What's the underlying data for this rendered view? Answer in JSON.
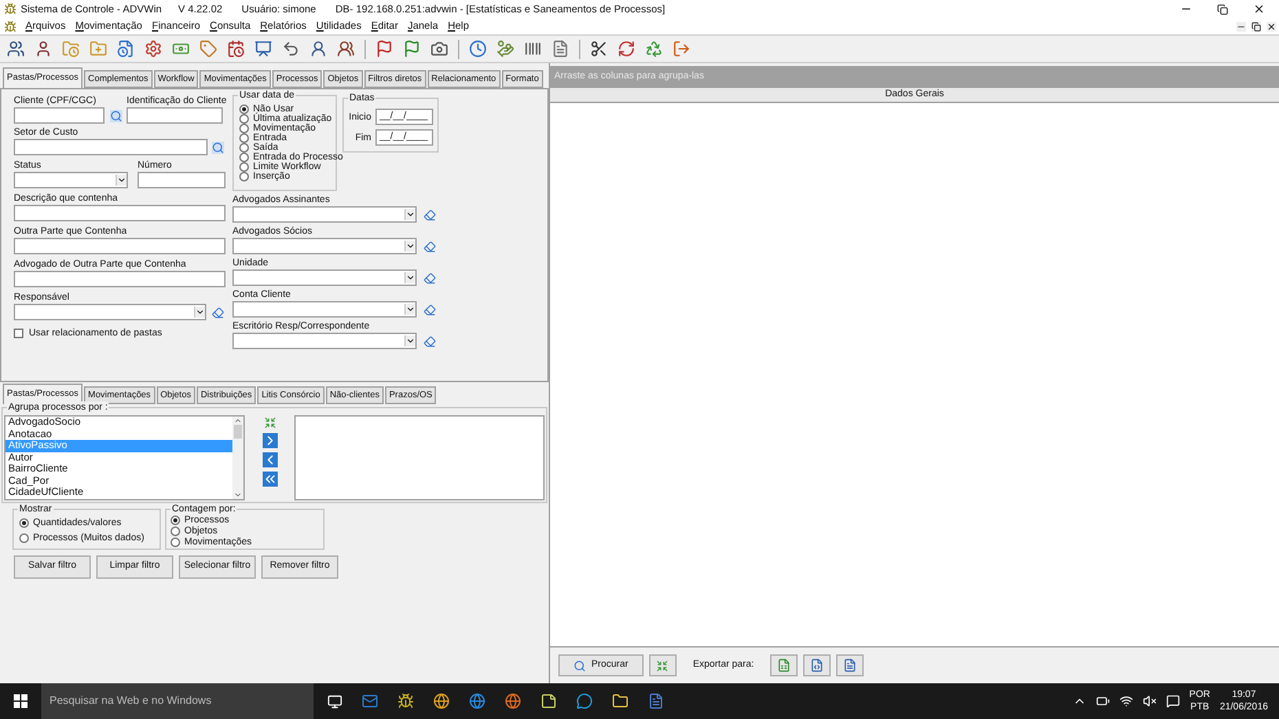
{
  "window": {
    "title": "Sistema de Controle - ADVWin",
    "version": "V 4.22.02",
    "user": "Usuário: simone",
    "database": "DB- 192.168.0.251:advwin - [Estatísticas e Saneamentos de Processos]"
  },
  "menu": [
    "Arquivos",
    "Movimentação",
    "Financeiro",
    "Consulta",
    "Relatórios",
    "Utilidades",
    "Editar",
    "Janela",
    "Help"
  ],
  "tabs": [
    {
      "label": "Pastas/Processos",
      "selected": true
    },
    {
      "label": "Complementos",
      "selected": false
    },
    {
      "label": "Workflow",
      "selected": false
    },
    {
      "label": "Movimentações",
      "selected": false
    },
    {
      "label": "Processos",
      "selected": false
    },
    {
      "label": "Objetos",
      "selected": false
    },
    {
      "label": "Filtros diretos",
      "selected": false
    },
    {
      "label": "Relacionamento",
      "selected": false
    },
    {
      "label": "Formato",
      "selected": false
    }
  ],
  "form": {
    "cliente": "Cliente (CPF/CGC)",
    "identificacao": "Identificação do Cliente",
    "setor": "Setor de Custo",
    "status": "Status",
    "numero": "Número",
    "text_fields": [
      "Descrição que contenha",
      "Outra Parte que Contenha",
      "Advogado de Outra Parte que Contenha"
    ],
    "responsavel": "Responsável",
    "checkbox": {
      "label": "Usar relacionamento de pastas",
      "checked": false
    },
    "usar_data": {
      "title": "Usar data de",
      "options": [
        {
          "label": "Não Usar",
          "selected": true
        },
        {
          "label": "Última atualização",
          "selected": false
        },
        {
          "label": "Movimentação",
          "selected": false
        },
        {
          "label": "Entrada",
          "selected": false
        },
        {
          "label": "Saída",
          "selected": false
        },
        {
          "label": "Entrada do Processo",
          "selected": false
        },
        {
          "label": "Limite Workflow",
          "selected": false
        },
        {
          "label": "Inserção",
          "selected": false
        }
      ]
    },
    "datas": {
      "title": "Datas",
      "fields": [
        {
          "label": "Inicio",
          "value": "__/__/____"
        },
        {
          "label": "Fim",
          "value": "__/__/____"
        }
      ]
    },
    "combos": [
      "Advogados Assinantes",
      "Advogados Sócios",
      "Unidade",
      "Conta Cliente",
      "Escritório Resp/Correspondente"
    ]
  },
  "lower_tabs": [
    {
      "label": "Pastas/Processos",
      "selected": true
    },
    {
      "label": "Movimentações",
      "selected": false
    },
    {
      "label": "Objetos",
      "selected": false
    },
    {
      "label": "Distribuições",
      "selected": false
    },
    {
      "label": "Litis Consórcio",
      "selected": false
    },
    {
      "label": "Não-clientes",
      "selected": false
    },
    {
      "label": "Prazos/OS",
      "selected": false
    }
  ],
  "group": {
    "title": "Agrupa processos por :",
    "items": [
      {
        "label": "AdvogadoSocio",
        "selected": false
      },
      {
        "label": "Anotacao",
        "selected": false
      },
      {
        "label": "AtivoPassivo",
        "selected": true
      },
      {
        "label": "Autor",
        "selected": false
      },
      {
        "label": "BairroCliente",
        "selected": false
      },
      {
        "label": "Cad_Por",
        "selected": false
      },
      {
        "label": "CidadeUfCliente",
        "selected": false
      }
    ]
  },
  "mostrar": {
    "title": "Mostrar",
    "options": [
      {
        "label": "Quantidades/valores",
        "selected": true
      },
      {
        "label": "Processos (Muitos dados)",
        "selected": false
      }
    ]
  },
  "contagem": {
    "title": "Contagem por:",
    "options": [
      {
        "label": "Processos",
        "selected": true
      },
      {
        "label": "Objetos",
        "selected": false
      },
      {
        "label": "Movimentações",
        "selected": false
      }
    ]
  },
  "buttons": [
    "Salvar filtro",
    "Limpar filtro",
    "Selecionar filtro",
    "Remover filtro"
  ],
  "grid": {
    "group_hint": "Arraste as colunas para agrupa-las",
    "column": "Dados Gerais"
  },
  "bottom_bar": {
    "search_button": "Procurar",
    "export_label": "Exportar para:"
  },
  "taskbar": {
    "search_placeholder": "Pesquisar na Web e no Windows",
    "language": "POR",
    "layout": "PTB",
    "time": "19:07",
    "date": "21/06/2016"
  }
}
